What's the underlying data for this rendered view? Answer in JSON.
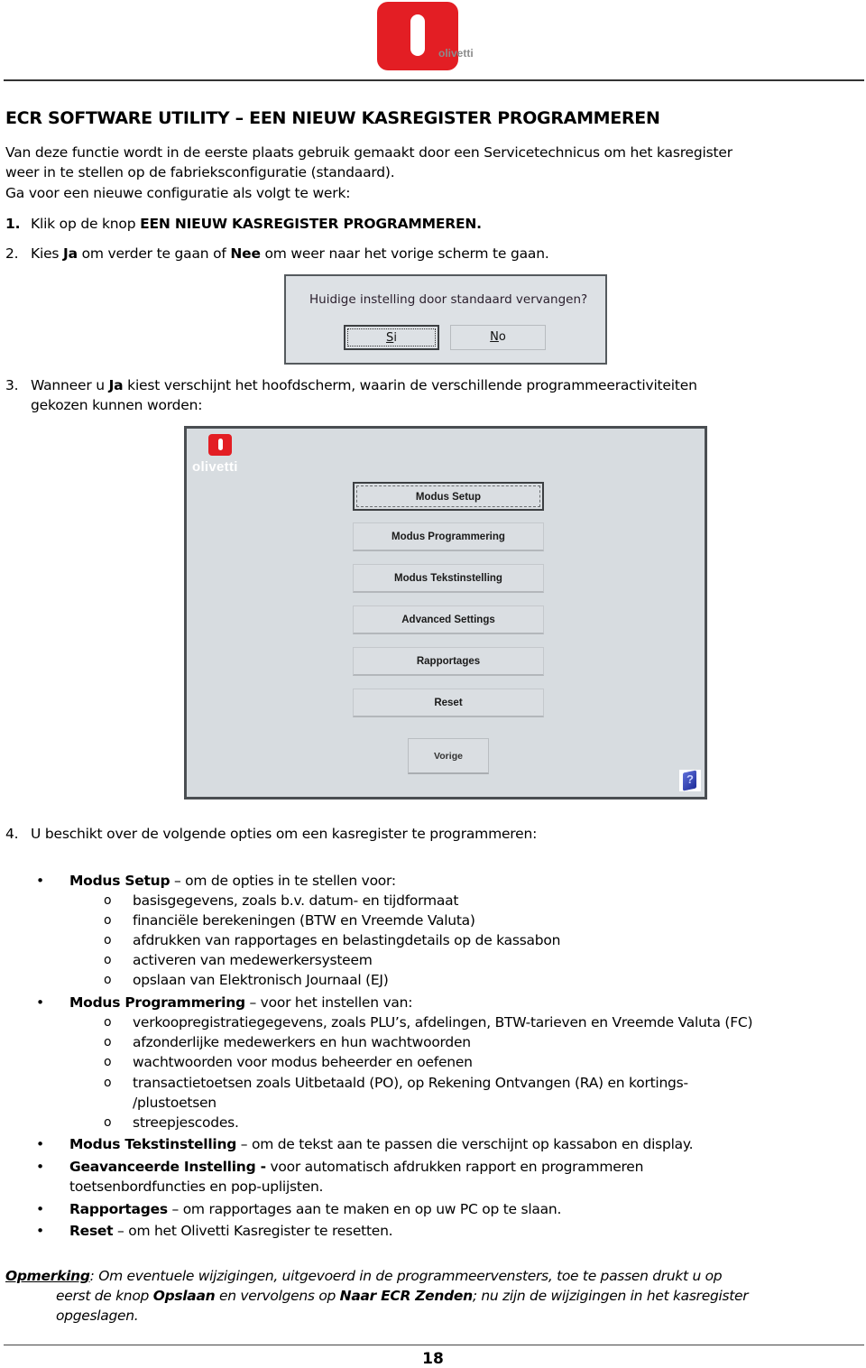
{
  "header": {
    "logo_text": "olivetti"
  },
  "title": "ECR SOFTWARE UTILITY – EEN NIEUW KASREGISTER PROGRAMMEREN",
  "intro": {
    "line1": "Van deze functie wordt in de eerste plaats gebruik gemaakt door een Servicetechnicus om het kasregister",
    "line2": "weer in te stellen op de fabrieksconfiguratie (standaard).",
    "line3": "Ga voor een nieuwe configuratie als volgt te werk:"
  },
  "steps": {
    "s1": {
      "num": "1.",
      "pre": "Klik op de knop ",
      "bold": "EEN NIEUW KASREGISTER PROGRAMMEREN."
    },
    "s2": {
      "num": "2.",
      "pre": "Kies ",
      "b1": "Ja",
      "mid": " om verder te gaan of ",
      "b2": "Nee",
      "post": " om weer naar het vorige scherm te gaan."
    },
    "s3": {
      "num": "3.",
      "pre": "Wanneer u ",
      "b1": "Ja",
      "post": " kiest verschijnt het hoofdscherm, waarin de verschillende programmeeractiviteiten",
      "line2": "gekozen kunnen worden:"
    },
    "s4": {
      "num": "4.",
      "text": "U beschikt over de volgende opties om een kasregister te programmeren:"
    }
  },
  "dialog": {
    "question": "Huidige instelling door standaard vervangen?",
    "yes_mnemonic": "S",
    "yes_rest": "i",
    "no_mnemonic": "N",
    "no_rest": "o"
  },
  "main_window": {
    "logo_text": "olivetti",
    "buttons": [
      {
        "label": "Modus Setup",
        "focused": true
      },
      {
        "label": "Modus Programmering"
      },
      {
        "label": "Modus Tekstinstelling"
      },
      {
        "label": "Advanced Settings"
      },
      {
        "label": "Rapportages"
      },
      {
        "label": "Reset"
      }
    ],
    "back_button": "Vorige",
    "help_icon": "help-book-icon"
  },
  "options": {
    "bullet": "•",
    "sub_bullet": "o",
    "setup": {
      "title": "Modus Setup",
      "desc": " – om de opties in te stellen voor:",
      "items": [
        "basisgegevens, zoals b.v. datum- en tijdformaat",
        "financiële berekeningen (BTW en Vreemde Valuta)",
        "afdrukken van rapportages en belastingdetails op de kassabon",
        "activeren van medewerkersysteem",
        "opslaan van Elektronisch Journaal (EJ)"
      ]
    },
    "programmering": {
      "title": "Modus Programmering",
      "desc": " – voor het instellen van:",
      "items": [
        "verkoopregistratiegegevens, zoals PLU’s, afdelingen, BTW-tarieven en Vreemde Valuta (FC)",
        "afzonderlijke medewerkers en hun wachtwoorden",
        "wachtwoorden voor modus beheerder en oefenen",
        "transactietoetsen zoals Uitbetaald (PO), op Rekening Ontvangen (RA) en kortings-",
        "/plustoetsen",
        "streepjescodes."
      ]
    },
    "tekst": {
      "title": "Modus Tekstinstelling",
      "desc": " – om de tekst aan te passen die verschijnt op kassabon en display."
    },
    "geavanceerd": {
      "title": "Geavanceerde Instelling -",
      "desc": " voor automatisch afdrukken rapport en programmeren",
      "line2": "toetsenbordfuncties en pop-uplijsten."
    },
    "rapportages": {
      "title": "Rapportages",
      "desc": " – om rapportages aan te maken en op uw PC op te slaan."
    },
    "reset": {
      "title": "Reset",
      "desc": " – om het Olivetti Kasregister te resetten."
    }
  },
  "note": {
    "label": "Opmerking",
    "t1": ": Om eventuele wijzigingen, uitgevoerd in de programmeervensters, toe te passen drukt u op",
    "t2": "eerst de knop ",
    "b1": "Opslaan",
    "t3": " en vervolgens op ",
    "b2": "Naar ECR Zenden",
    "t4": ";  nu zijn de wijzigingen in het kasregister",
    "t5": "opgeslagen."
  },
  "footer": {
    "page_number": "18"
  }
}
